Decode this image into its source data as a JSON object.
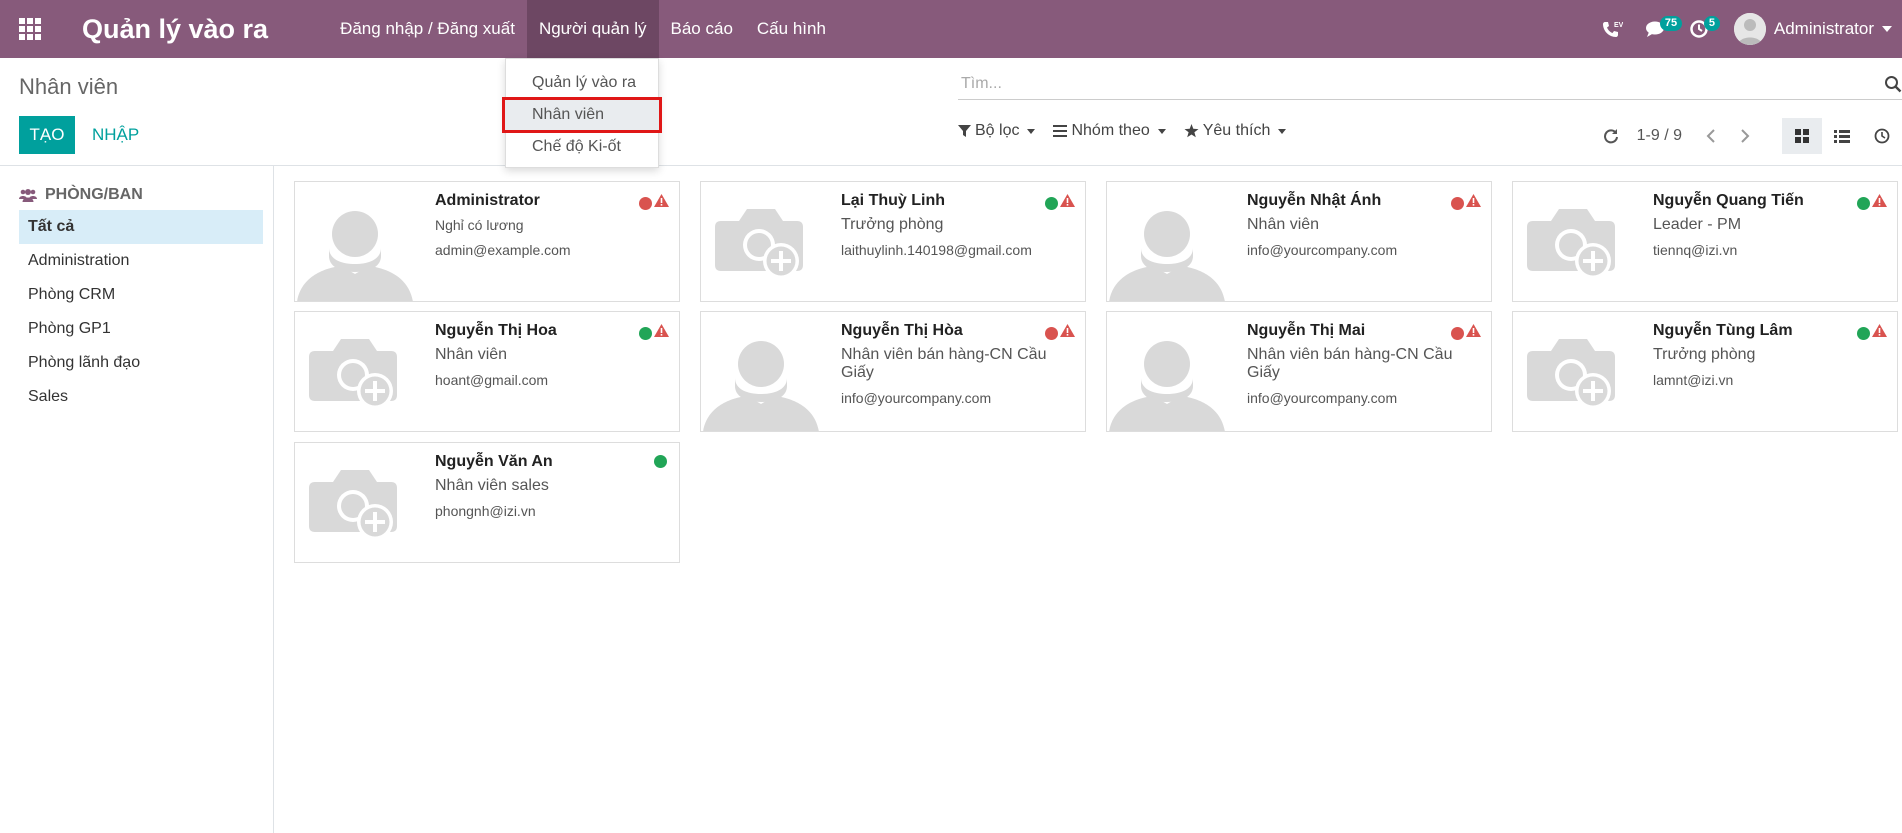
{
  "navbar": {
    "app_title": "Quản lý vào ra",
    "menus": [
      "Đăng nhập / Đăng xuất",
      "Người quản lý",
      "Báo cáo",
      "Cấu hình"
    ],
    "messages_count": "75",
    "activities_count": "5",
    "user": "Administrator",
    "phone_icon_label": "EV"
  },
  "dropdown": {
    "items": [
      "Quản lý vào ra",
      "Nhân viên",
      "Chế độ Ki-ốt"
    ]
  },
  "control_panel": {
    "breadcrumb": "Nhân viên",
    "create_label": "TẠO",
    "import_label": "NHẬP",
    "search_placeholder": "Tìm...",
    "filter_label": "Bộ lọc",
    "group_label": "Nhóm theo",
    "favorite_label": "Yêu thích",
    "pager_value": "1-9 / 9"
  },
  "sidebar": {
    "header": "PHÒNG/BAN",
    "items": [
      "Tất cả",
      "Administration",
      "Phòng CRM",
      "Phòng GP1",
      "Phòng lãnh đạo",
      "Sales"
    ]
  },
  "employees": [
    {
      "name": "Administrator",
      "job": "Nghỉ có lương",
      "email": "admin@example.com",
      "status": "red",
      "warning": true,
      "image": "person"
    },
    {
      "name": "Lại Thuỳ Linh",
      "job": "Trưởng phòng",
      "email": "laithuylinh.140198@gmail.com",
      "status": "green",
      "warning": true,
      "image": "camera"
    },
    {
      "name": "Nguyễn Nhật Ánh",
      "job": "Nhân viên",
      "email": "info@yourcompany.com",
      "status": "red",
      "warning": true,
      "image": "person"
    },
    {
      "name": "Nguyễn Quang Tiến",
      "job": "Leader - PM",
      "email": "tiennq@izi.vn",
      "status": "green",
      "warning": true,
      "image": "camera"
    },
    {
      "name": "Nguyễn Thị Hoa",
      "job": "Nhân viên",
      "email": "hoant@gmail.com",
      "status": "green",
      "warning": true,
      "image": "camera"
    },
    {
      "name": "Nguyễn Thị Hòa",
      "job": "Nhân viên bán hàng-CN Cầu Giấy",
      "email": "info@yourcompany.com",
      "status": "red",
      "warning": true,
      "image": "person"
    },
    {
      "name": "Nguyễn Thị Mai",
      "job": "Nhân viên bán hàng-CN Cầu Giấy",
      "email": "info@yourcompany.com",
      "status": "red",
      "warning": true,
      "image": "person"
    },
    {
      "name": "Nguyễn Tùng Lâm",
      "job": "Trưởng phòng",
      "email": "lamnt@izi.vn",
      "status": "green",
      "warning": true,
      "image": "camera"
    },
    {
      "name": "Nguyễn Văn An",
      "job": "Nhân viên sales",
      "email": "phongnh@izi.vn",
      "status": "green",
      "warning": false,
      "image": "camera"
    }
  ],
  "colors": {
    "brand": "#875a7b",
    "primary": "#00a09d",
    "status_green": "#21a557",
    "status_red": "#d9534f",
    "highlight_border": "#e01717"
  }
}
